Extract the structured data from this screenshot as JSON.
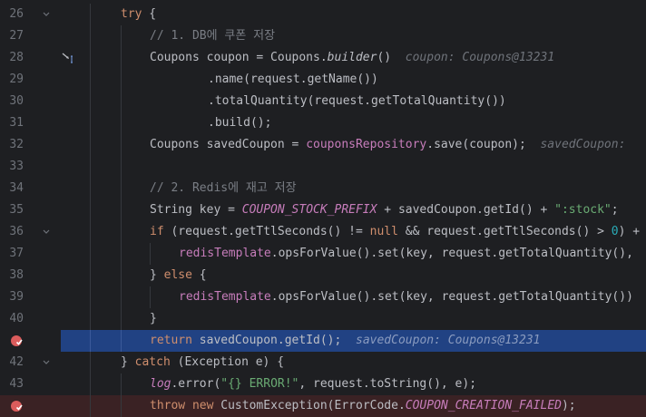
{
  "lines": [
    {
      "num": "26",
      "fold": true
    },
    {
      "num": "27"
    },
    {
      "num": "28"
    },
    {
      "num": "29"
    },
    {
      "num": "30"
    },
    {
      "num": "31"
    },
    {
      "num": "32"
    },
    {
      "num": "33"
    },
    {
      "num": "34"
    },
    {
      "num": "35"
    },
    {
      "num": "36",
      "fold": true
    },
    {
      "num": "37"
    },
    {
      "num": "38"
    },
    {
      "num": "39"
    },
    {
      "num": "40"
    },
    {
      "num": "41",
      "breakpoint": true,
      "current": true
    },
    {
      "num": "42",
      "fold": true
    },
    {
      "num": "43"
    },
    {
      "num": "44",
      "breakpoint": true,
      "error": true
    }
  ],
  "code": {
    "l26": {
      "kw": "try",
      "rest": " {"
    },
    "l27": {
      "comment": "// 1. DB에 쿠폰 저장"
    },
    "l28": {
      "a": "Coupons coupon = Coupons.",
      "m": "builder",
      "b": "()",
      "hint": "coupon: Coupons@13231"
    },
    "l29": {
      "a": ".name(request.getName())"
    },
    "l30": {
      "a": ".totalQuantity(request.getTotalQuantity())"
    },
    "l31": {
      "a": ".build();"
    },
    "l32": {
      "a": "Coupons savedCoupon = ",
      "f": "couponsRepository",
      "b": ".save(coupon);",
      "hint": "savedCoupon:"
    },
    "l34": {
      "comment": "// 2. Redis에 재고 저장"
    },
    "l35": {
      "a": "String key = ",
      "c": "COUPON_STOCK_PREFIX",
      "b": " + savedCoupon.getId() + ",
      "s": "\":stock\"",
      "e": ";"
    },
    "l36": {
      "kw": "if",
      "a": " (request.getTtlSeconds() != ",
      "kw2": "null",
      "b": " && request.getTtlSeconds() > ",
      "n": "0",
      "e": ") +"
    },
    "l37": {
      "f": "redisTemplate",
      "a": ".opsForValue().set(key, request.getTotalQuantity(),"
    },
    "l38": {
      "a": "} ",
      "kw": "else",
      "b": " {"
    },
    "l39": {
      "f": "redisTemplate",
      "a": ".opsForValue().set(key, request.getTotalQuantity())"
    },
    "l40": {
      "a": "}"
    },
    "l41": {
      "kw": "return",
      "a": " savedCoupon.getId();",
      "hint": "savedCoupon: Coupons@13231"
    },
    "l42": {
      "a": "} ",
      "kw": "catch",
      "b": " (Exception e) {"
    },
    "l43": {
      "lg": "log",
      "a": ".error(",
      "s": "\"{} ERROR!\"",
      "b": ", request.toString(), e);"
    },
    "l44": {
      "kw": "throw",
      "kw2": "new",
      "a": " CustomException(ErrorCode.",
      "c": "COUPON_CREATION_FAILED",
      "b": ");"
    }
  },
  "colors": {
    "background": "#1e1f22",
    "current_line": "#214283",
    "error_line": "#3a2224",
    "breakpoint": "#db5c5c"
  }
}
